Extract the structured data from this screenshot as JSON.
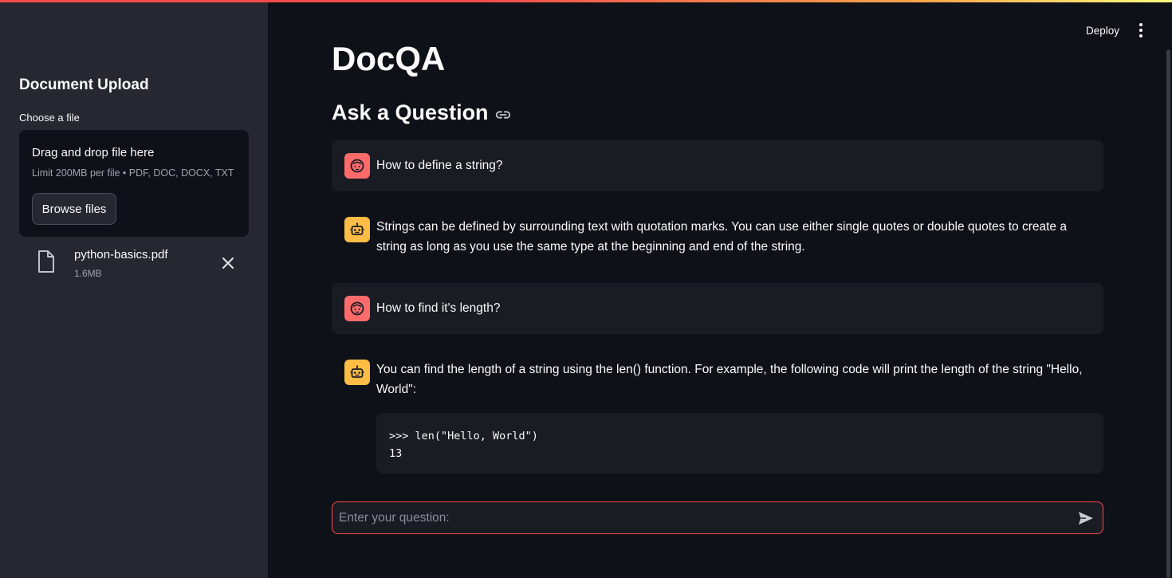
{
  "sidebar": {
    "title": "Document Upload",
    "uploader_label": "Choose a file",
    "dropzone": {
      "title": "Drag and drop file here",
      "limit_text": "Limit 200MB per file • PDF, DOC, DOCX, TXT",
      "browse_label": "Browse files"
    },
    "uploaded_file": {
      "name": "python-basics.pdf",
      "size": "1.6MB",
      "icon": "file-icon"
    }
  },
  "header": {
    "deploy_label": "Deploy",
    "menu_icon": "more-vertical-icon"
  },
  "main": {
    "title": "DocQA",
    "section_heading": "Ask a Question",
    "messages": [
      {
        "role": "user",
        "text": "How to define a string?"
      },
      {
        "role": "assistant",
        "text": "Strings can be defined by surrounding text with quotation marks. You can use either single quotes or double quotes to create a string as long as you use the same type at the beginning and end of the string."
      },
      {
        "role": "user",
        "text": "How to find it's length?"
      },
      {
        "role": "assistant",
        "text": "You can find the length of a string using the len() function. For example, the following code will print the length of the string \"Hello, World\":",
        "code": ">>> len(\"Hello, World\")\n13"
      }
    ],
    "chat_input": {
      "placeholder": "Enter your question:",
      "value": ""
    }
  },
  "colors": {
    "accent": "#ff4b4b",
    "user_avatar": "#ff6b6b",
    "assistant_avatar": "#ffbd45",
    "sidebar_bg": "#262730",
    "main_bg": "#0e1117"
  }
}
